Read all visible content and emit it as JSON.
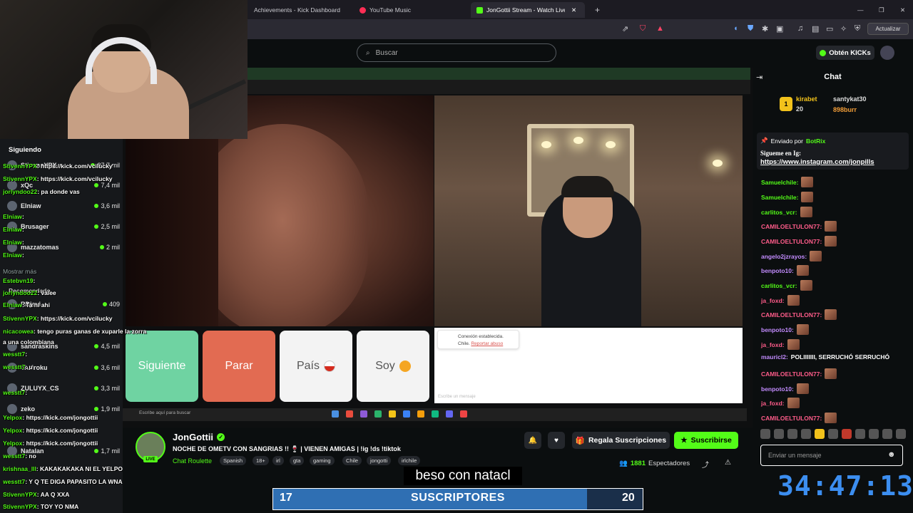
{
  "browser": {
    "tabs": [
      {
        "label": "Achievements - Kick Dashboard"
      },
      {
        "label": "YouTube Music"
      },
      {
        "label": "JonGottii Stream - Watch Live"
      }
    ],
    "new_tab": "+",
    "update_label": "Actualizar",
    "window_controls": [
      "—",
      "❐",
      "✕"
    ]
  },
  "kick": {
    "search_placeholder": "Buscar",
    "get_kicks": "Obtén KICKs",
    "accent_color": "#53fc18"
  },
  "sidebar": {
    "title": "Siguiendo",
    "items": [
      {
        "name": "StivennYPX",
        "count": "87,7 mil"
      },
      {
        "name": "xQc",
        "count": "7,4 mil"
      },
      {
        "name": "Elniaw",
        "count": "3,6 mil"
      },
      {
        "name": "Brusager",
        "count": "2,5 mil"
      },
      {
        "name": "mazzatomas",
        "count": "2 mil"
      },
      {
        "name": "RDjavi",
        "count": "409"
      },
      {
        "name": "sandraskins",
        "count": "4,5 mil"
      },
      {
        "name": "shairoku",
        "count": "3,6 mil"
      },
      {
        "name": "ZULUYX_CS",
        "count": "3,3 mil"
      },
      {
        "name": "zeko",
        "count": "1,9 mil"
      },
      {
        "name": "Natalan",
        "count": "1,7 mil"
      }
    ],
    "show_more": "Mostrar más",
    "recommended": "Recomendado"
  },
  "overlay_chat": [
    {
      "user": "StivennYPX",
      "text": ": https://kick.com/vcilucky"
    },
    {
      "user": "StivennYPX",
      "text": ": https://kick.com/vcilucky"
    },
    {
      "user": "jorlyndoo22",
      "text": ": pa donde vas"
    },
    {
      "user": "Elniaw",
      "text": ":"
    },
    {
      "user": "Elniaw",
      "text": ":"
    },
    {
      "user": "Elniaw",
      "text": ":"
    },
    {
      "user": "Elniaw",
      "text": ":"
    },
    {
      "user": "Elniaw",
      "text": ":"
    },
    {
      "user": "Estebvn19",
      "text": ":"
    },
    {
      "user": "jorlyndoo22",
      "text": ": valee"
    },
    {
      "user": "Elniaw",
      "text": ": Ta ni ahi"
    },
    {
      "user": "StivennYPX",
      "text": ": https://kick.com/vcilucky"
    },
    {
      "user": "nicacowea",
      "text": ": tengo puras ganas de xuparle la zorra"
    },
    {
      "user": "",
      "text": "a una colombiana"
    },
    {
      "user": "wesstt7",
      "text": ":"
    },
    {
      "user": "wesstt7",
      "text": ": u"
    },
    {
      "user": "wesstt7",
      "text": ":"
    },
    {
      "user": "wesstt7",
      "text": ":"
    },
    {
      "user": "Yelpox",
      "text": ": https://kick.com/jongottii"
    },
    {
      "user": "Yelpox",
      "text": ": https://kick.com/jongottii"
    },
    {
      "user": "Yelpox",
      "text": ": https://kick.com/jongottii"
    },
    {
      "user": "wesstt7",
      "text": ": no"
    },
    {
      "user": "krishnaa_lll",
      "text": ": KAKAKAKAKA NI EL YELPOX"
    },
    {
      "user": "wesstt7",
      "text": ": Y Q TE DIGA PAPASITO LA WNAA"
    },
    {
      "user": "StivennYPX",
      "text": ": AA Q XXA"
    },
    {
      "user": "StivennYPX",
      "text": ": TOY YO NMA"
    }
  ],
  "ometv": {
    "next": "Siguiente",
    "stop": "Parar",
    "country": "País",
    "me": "Soy",
    "connection": "Conexión establecida.",
    "country_name": "Chile.",
    "report": "Reportar abuso",
    "message_placeholder": "Escribe un mensaje",
    "taskbar_search": "Escribe aquí para buscar"
  },
  "streamer": {
    "name": "JonGottii",
    "live": "LIVE",
    "title": "NOCHE DE OMETV CON SANGRIAS !! 🍷 | VIENEN AMIGAS | !ig !ds !tiktok",
    "category": "Chat Roulette",
    "tags": [
      "Spanish",
      "18+",
      "irl",
      "gta",
      "gaming",
      "Chile",
      "jongotti",
      "irlchile"
    ],
    "gift_label": "Regala Suscripciones",
    "subscribe_label": "Suscribirse",
    "viewers_count": "1881",
    "viewers_label": "Espectadores"
  },
  "overlays": {
    "caption": "beso con natacl",
    "subgoal_current": "17",
    "subgoal_label": "SUSCRIPTORES",
    "subgoal_target": "20",
    "subgoal_progress": 0.85,
    "timer": "34:47:13"
  },
  "chat": {
    "title": "Chat",
    "gifters": [
      {
        "name": "kirabet",
        "value": "20"
      },
      {
        "name": "santykat30",
        "value": ""
      },
      {
        "name": "898burr",
        "value": ""
      }
    ],
    "pinned_by_label": "Enviado por",
    "pinned_by": "BotRix",
    "pinned_text": "Sigueme en Ig:",
    "pinned_link": "https://www.instagram.com/jonpills",
    "messages": [
      {
        "user": "Samuelchile:",
        "color": "#53fc18",
        "text": ""
      },
      {
        "user": "Samuelchile:",
        "color": "#53fc18",
        "text": ""
      },
      {
        "user": "carlitos_vcr:",
        "color": "#53fc18",
        "text": ""
      },
      {
        "user": "CAMILOELTULON77:",
        "color": "#ff5c8a",
        "text": ""
      },
      {
        "user": "CAMILOELTULON77:",
        "color": "#ff5c8a",
        "text": ""
      },
      {
        "user": "angelo2jzrayos:",
        "color": "#c38cff",
        "text": ""
      },
      {
        "user": "benpoto10:",
        "color": "#c38cff",
        "text": ""
      },
      {
        "user": "carlitos_vcr:",
        "color": "#53fc18",
        "text": ""
      },
      {
        "user": "ja_foxd:",
        "color": "#ff5c8a",
        "text": ""
      },
      {
        "user": "CAMILOELTULON77:",
        "color": "#ff5c8a",
        "text": ""
      },
      {
        "user": "benpoto10:",
        "color": "#c38cff",
        "text": ""
      },
      {
        "user": "ja_foxd:",
        "color": "#ff5c8a",
        "text": ""
      },
      {
        "user": "mauricl2:",
        "color": "#c38cff",
        "text": "POLIIIIIII, SERRUCHÓ SERRUCHÓ"
      },
      {
        "user": "CAMILOELTULON77:",
        "color": "#ff5c8a",
        "text": ""
      },
      {
        "user": "benpoto10:",
        "color": "#c38cff",
        "text": ""
      },
      {
        "user": "ja_foxd:",
        "color": "#ff5c8a",
        "text": ""
      },
      {
        "user": "CAMILOELTULON77:",
        "color": "#ff5c8a",
        "text": ""
      }
    ],
    "input_placeholder": "Enviar un mensaje"
  }
}
